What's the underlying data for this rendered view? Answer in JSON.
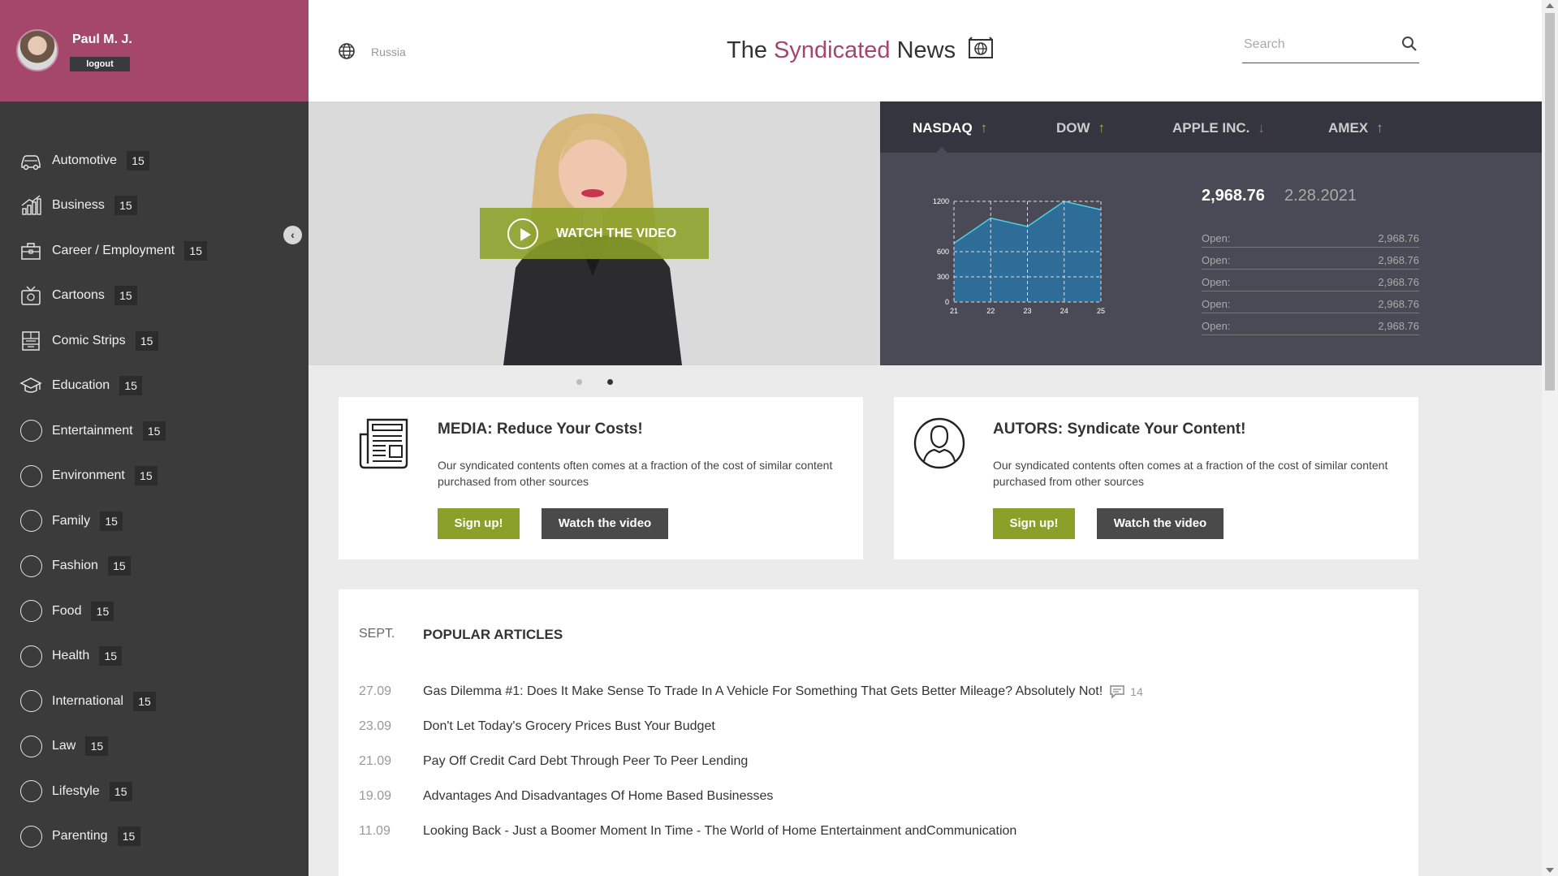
{
  "user": {
    "name": "Paul M. J.",
    "logout_label": "logout"
  },
  "sidebar": {
    "categories": [
      {
        "label": "Automotive",
        "count": "15",
        "icon": "car-icon"
      },
      {
        "label": "Business",
        "count": "15",
        "icon": "business-chart-icon"
      },
      {
        "label": "Career / Employment",
        "count": "15",
        "icon": "briefcase-icon"
      },
      {
        "label": "Cartoons",
        "count": "15",
        "icon": "tv-icon"
      },
      {
        "label": "Comic Strips",
        "count": "15",
        "icon": "comic-icon"
      },
      {
        "label": "Education",
        "count": "15",
        "icon": "graduation-cap-icon"
      },
      {
        "label": "Entertainment",
        "count": "15",
        "icon": "circle-icon"
      },
      {
        "label": "Environment",
        "count": "15",
        "icon": "circle-icon"
      },
      {
        "label": "Family",
        "count": "15",
        "icon": "circle-icon"
      },
      {
        "label": "Fashion",
        "count": "15",
        "icon": "circle-icon"
      },
      {
        "label": "Food",
        "count": "15",
        "icon": "circle-icon"
      },
      {
        "label": "Health",
        "count": "15",
        "icon": "circle-icon"
      },
      {
        "label": "International",
        "count": "15",
        "icon": "circle-icon"
      },
      {
        "label": "Law",
        "count": "15",
        "icon": "circle-icon"
      },
      {
        "label": "Lifestyle",
        "count": "15",
        "icon": "circle-icon"
      },
      {
        "label": "Parenting",
        "count": "15",
        "icon": "circle-icon"
      }
    ]
  },
  "header": {
    "region": "Russia",
    "title_part1": "The",
    "title_accent": "Syndicated",
    "title_part2": "News",
    "search_placeholder": "Search"
  },
  "hero": {
    "watch_label": "WATCH THE VIDEO",
    "slides": 2,
    "active_slide": 2
  },
  "stocks": {
    "tabs": [
      {
        "label": "NASDAQ",
        "trend": "up",
        "arrow": "↑"
      },
      {
        "label": "DOW",
        "trend": "up",
        "arrow": "↑"
      },
      {
        "label": "APPLE INC.",
        "trend": "down",
        "arrow": "↓"
      },
      {
        "label": "AMEX",
        "trend": "up",
        "arrow": "↑"
      }
    ],
    "value": "2,968.76",
    "date": "2.28.2021",
    "rows": [
      {
        "label": "Open:",
        "value": "2,968.76"
      },
      {
        "label": "Open:",
        "value": "2,968.76"
      },
      {
        "label": "Open:",
        "value": "2,968.76"
      },
      {
        "label": "Open:",
        "value": "2,968.76"
      },
      {
        "label": "Open:",
        "value": "2,968.76"
      }
    ]
  },
  "chart_data": {
    "type": "area",
    "x": [
      21,
      22,
      23,
      24,
      25
    ],
    "y_ticks": [
      0,
      300,
      600,
      1200
    ],
    "ylim": [
      0,
      1200
    ],
    "series": [
      {
        "x": [
          21,
          22,
          23,
          24,
          25
        ],
        "values": [
          700,
          1000,
          900,
          1200,
          1100
        ]
      }
    ],
    "colors": {
      "fill": "#2f6d99",
      "line": "#4fd0e0"
    }
  },
  "cards": [
    {
      "title": "MEDIA: Reduce Your Costs!",
      "desc": "Our syndicated contents often comes at a fraction of the cost of similar content purchased from other sources",
      "signup": "Sign up!",
      "video": "Watch the video"
    },
    {
      "title": "AUTORS: Syndicate Your Content!",
      "desc": "Our syndicated contents often comes at a fraction of the cost of similar content purchased from other sources",
      "signup": "Sign up!",
      "video": "Watch the video"
    }
  ],
  "articles": {
    "month": "SEPT.",
    "section_title": "POPULAR ARTICLES",
    "items": [
      {
        "date": "27.09",
        "title": "Gas Dilemma #1: Does It Make Sense To Trade In A Vehicle For Something That Gets Better Mileage? Absolutely Not!",
        "comments": "14"
      },
      {
        "date": "23.09",
        "title": "Don't Let Today's Grocery Prices Bust Your Budget"
      },
      {
        "date": "21.09",
        "title": "Pay Off Credit Card Debt Through Peer To Peer Lending"
      },
      {
        "date": "19.09",
        "title": "Advantages And Disadvantages Of Home Based Businesses"
      },
      {
        "date": "11.09",
        "title": "Looking Back - Just a Boomer Moment In Time - The World of Home Entertainment andCommunication"
      }
    ]
  },
  "colors": {
    "accent": "#a4476b",
    "green": "#8aa028",
    "sidebar": "#3b3b3b",
    "dark_panel": "#4a4a57"
  }
}
